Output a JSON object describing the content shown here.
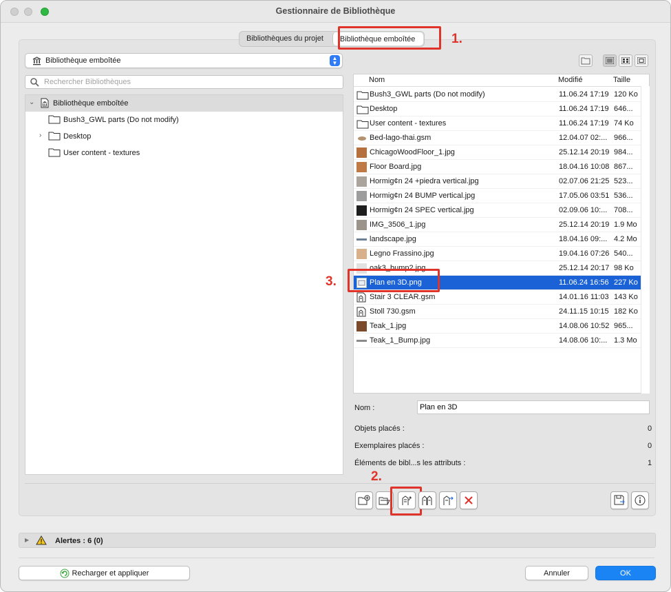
{
  "window": {
    "title": "Gestionnaire de Bibliothèque"
  },
  "tabs": [
    {
      "label": "Bibliothèques du projet",
      "active": false
    },
    {
      "label": "Bibliothèque emboîtée",
      "active": true
    }
  ],
  "annotations": {
    "step1": "1.",
    "step2": "2.",
    "step3": "3."
  },
  "library_select": {
    "value": "Bibliothèque emboîtée",
    "icon": "library-icon"
  },
  "search": {
    "placeholder": "Rechercher Bibliothèques"
  },
  "tree": [
    {
      "label": "Bibliothèque emboîtée",
      "level": 0,
      "expanded": true,
      "selected": true,
      "icon": "library-icon"
    },
    {
      "label": "Bush3_GWL parts (Do not modify)",
      "level": 1,
      "expandable": false,
      "icon": "folder-icon"
    },
    {
      "label": "Desktop",
      "level": 1,
      "expandable": true,
      "icon": "folder-icon"
    },
    {
      "label": "User content - textures",
      "level": 1,
      "expandable": false,
      "icon": "folder-icon"
    }
  ],
  "file_columns": {
    "name": "Nom",
    "modified": "Modifié",
    "size": "Taille"
  },
  "files": [
    {
      "name": "Bush3_GWL parts (Do not modify)",
      "modified": "11.06.24 17:19",
      "size": "120 Ko",
      "kind": "folder"
    },
    {
      "name": "Desktop",
      "modified": "11.06.24 17:19",
      "size": "646...",
      "kind": "folder"
    },
    {
      "name": "User content - textures",
      "modified": "11.06.24 17:19",
      "size": "74 Ko",
      "kind": "folder"
    },
    {
      "name": "Bed-lago-thai.gsm",
      "modified": "12.04.07 02:...",
      "size": "966...",
      "kind": "bed",
      "color": "#b49270"
    },
    {
      "name": "ChicagoWoodFloor_1.jpg",
      "modified": "25.12.14 20:19",
      "size": "984...",
      "kind": "img",
      "color": "#b5703e"
    },
    {
      "name": "Floor Board.jpg",
      "modified": "18.04.16 10:08",
      "size": "867...",
      "kind": "img",
      "color": "#c07a45"
    },
    {
      "name": "Hormig¢n 24 +piedra vertical.jpg",
      "modified": "02.07.06 21:25",
      "size": "523...",
      "kind": "img",
      "color": "#aaa49c"
    },
    {
      "name": "Hormig¢n 24 BUMP vertical.jpg",
      "modified": "17.05.06 03:51",
      "size": "536...",
      "kind": "img",
      "color": "#9d9d9d"
    },
    {
      "name": "Hormig¢n 24 SPEC vertical.jpg",
      "modified": "02.09.06 10:...",
      "size": "708...",
      "kind": "img",
      "color": "#1d1d1d"
    },
    {
      "name": "IMG_3506_1.jpg",
      "modified": "25.12.14 20:19",
      "size": "1.9 Mo",
      "kind": "img",
      "color": "#9a948a"
    },
    {
      "name": "landscape.jpg",
      "modified": "18.04.16 09:...",
      "size": "4.2 Mo",
      "kind": "strip",
      "color": "#6c7f95"
    },
    {
      "name": "Legno Frassino.jpg",
      "modified": "19.04.16 07:26",
      "size": "540...",
      "kind": "img",
      "color": "#d9b08c"
    },
    {
      "name": "oak3_bump2.jpg",
      "modified": "25.12.14 20:17",
      "size": "98 Ko",
      "kind": "img",
      "color": "#e2e2e2"
    },
    {
      "name": "Plan en 3D.png",
      "modified": "11.06.24 16:56",
      "size": "227 Ko",
      "kind": "plan",
      "selected": true,
      "color": "#e9eef5"
    },
    {
      "name": "Stair 3 CLEAR.gsm",
      "modified": "14.01.16 11:03",
      "size": "143 Ko",
      "kind": "gsm"
    },
    {
      "name": "Stoll 730.gsm",
      "modified": "24.11.15 10:15",
      "size": "182 Ko",
      "kind": "gsm"
    },
    {
      "name": "Teak_1.jpg",
      "modified": "14.08.06 10:52",
      "size": "965...",
      "kind": "img",
      "color": "#7a4a2a"
    },
    {
      "name": "Teak_1_Bump.jpg",
      "modified": "14.08.06 10:...",
      "size": "1.3 Mo",
      "kind": "strip",
      "color": "#8a8a8a"
    }
  ],
  "details": {
    "name_label": "Nom :",
    "name_value": "Plan en 3D",
    "placed_objects_label": "Objets placés :",
    "placed_objects_value": "0",
    "placed_instances_label": "Exemplaires placés :",
    "placed_instances_value": "0",
    "attribute_elements_label": "Éléments de bibl...s les attributs :",
    "attribute_elements_value": "1"
  },
  "alerts": {
    "label": "Alertes : 6 (0)"
  },
  "footer": {
    "reload_label": "Recharger et appliquer",
    "cancel_label": "Annuler",
    "ok_label": "OK"
  },
  "colors": {
    "accent": "#1a84f5",
    "selection": "#1a62d6",
    "annotation_red": "#e0332a"
  }
}
